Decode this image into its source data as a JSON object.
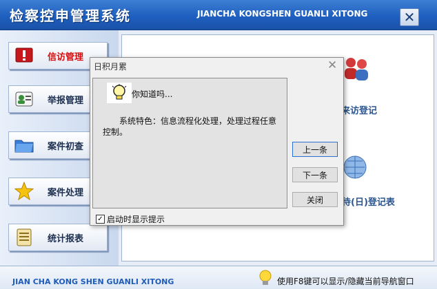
{
  "app": {
    "title": "检察控申管理系统",
    "pinyin": "JIANCHA KONGSHEN GUANLI XITONG"
  },
  "sidebar": {
    "items": [
      {
        "label": "信访管理",
        "icon": "alert-icon",
        "active": true
      },
      {
        "label": "举报管理",
        "icon": "contact-card-icon",
        "active": false
      },
      {
        "label": "案件初查",
        "icon": "folder-icon",
        "active": false
      },
      {
        "label": "案件处理",
        "icon": "star-icon",
        "active": false
      },
      {
        "label": "统计报表",
        "icon": "document-icon",
        "active": false
      }
    ]
  },
  "main": {
    "func_visit_label": "来访登记",
    "func_daily_label": "接待(日)登记表"
  },
  "dialog": {
    "title": "日积月累",
    "heading": "你知道吗...",
    "tip": "系统特色：信息流程化处理，处理过程任意控制。",
    "prev_label": "上一条",
    "next_label": "下一条",
    "close_label": "关闭",
    "show_on_start_label": "启动时显示提示",
    "show_on_start_checked": true
  },
  "footer": {
    "pinyin": "JIAN CHA KONG SHEN GUANLI XITONG",
    "hint": "使用F8键可以显示/隐藏当前导航窗口"
  },
  "colors": {
    "header": "#1f5fbf",
    "active_nav": "#d40f0f",
    "func_label": "#2a5591"
  }
}
